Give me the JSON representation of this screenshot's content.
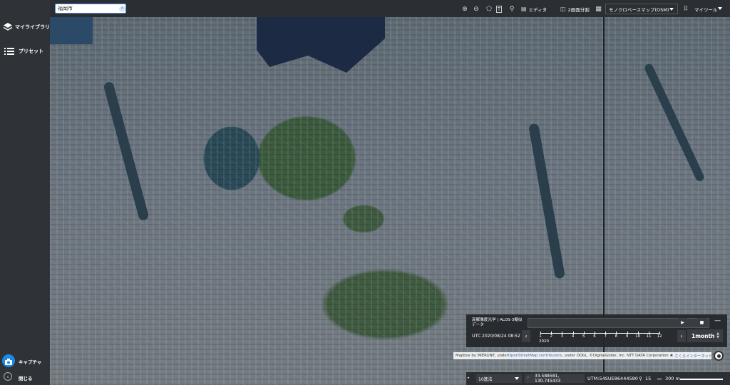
{
  "sidebar": {
    "items": [
      {
        "label": "マイライブラリ",
        "icon": "layers-icon"
      },
      {
        "label": "プリセット",
        "icon": "list-icon"
      }
    ],
    "capture_label": "キャプチャ",
    "close_label": "閉じる"
  },
  "search": {
    "value": "福岡市",
    "placeholder": ""
  },
  "toolbar": {
    "editor_label": "エディタ",
    "split_label": "2画面分割",
    "basemap_value": "モノクロベースマップ(OSM)",
    "mytools_label": "マイツール"
  },
  "time_panel": {
    "title": "高解像度光学 | ALOS-3擬似データ",
    "utc_label": "UTC",
    "date": "2020/08/24 08:52",
    "year": "2020",
    "months": [
      "1",
      "2",
      "3",
      "4",
      "5",
      "6",
      "7",
      "8",
      "9",
      "10",
      "11",
      "12"
    ],
    "period": "1month"
  },
  "attribution": {
    "prefix": "Mapbox by MIERUNE, under ",
    "osm_link": "OpenStreetMap contributors",
    "suffix": ", under ODbL. ©DigitalGlobe, Inc. NTT DATA Corporation",
    "sakura_link": "さくらインターネット"
  },
  "status": {
    "grid_value": "10進法",
    "coords": "33.588581, 130.745433",
    "utm": "UTM:54SUE86444580",
    "zoom": "15",
    "scale": "300 m"
  },
  "colors": {
    "accent": "#1e88e5",
    "panel": "#2b2f33"
  }
}
